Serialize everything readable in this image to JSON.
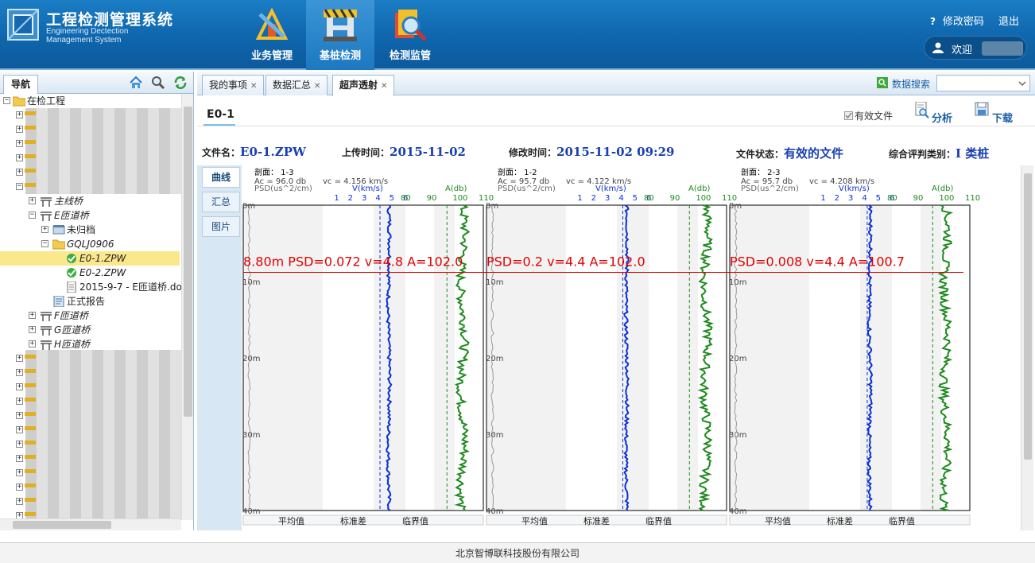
{
  "header": {
    "title": "工程检测管理系统",
    "subtitle_line1": "Engineering Dectection",
    "subtitle_line2": "Management System",
    "nav": [
      {
        "label": "业务管理",
        "icon": "business-management-icon",
        "active": false
      },
      {
        "label": "基桩检测",
        "icon": "pile-inspection-icon",
        "active": true
      },
      {
        "label": "检测监管",
        "icon": "inspection-supervision-icon",
        "active": false
      }
    ],
    "change_password": "修改密码",
    "logout": "退出",
    "welcome": "欢迎",
    "help_icon": "question-mark-icon"
  },
  "sidebar": {
    "tab_label": "导航",
    "home_icon": "home-icon",
    "search_icon": "magnifier-icon",
    "refresh_icon": "refresh-icon",
    "tree": {
      "root": "在检工程",
      "bridge_main": "主线桥",
      "bridge_e": "E匝道桥",
      "unarchived": "未归档",
      "folder": "GQLJ0906",
      "file_e0_1": "E0-1.ZPW",
      "file_e0_2": "E0-2.ZPW",
      "doc_file": "2015-9-7 - E匝道桥.do",
      "formal_report": "正式报告",
      "bridge_f": "F匝道桥",
      "bridge_g": "G匝道桥",
      "bridge_h": "H匝道桥"
    }
  },
  "tabs": [
    {
      "label": "我的事项",
      "active": false
    },
    {
      "label": "数据汇总",
      "active": false
    },
    {
      "label": "超声透射",
      "active": true
    }
  ],
  "data_search": {
    "label": "数据搜索",
    "value": ""
  },
  "document": {
    "title": "E0-1",
    "valid_file_checkbox": "有效文件",
    "valid_checked": true,
    "analyze_label": "分析",
    "download_label": "下载",
    "file_name_key": "文件名：",
    "file_name": "E0-1.ZPW",
    "upload_time_key": "上传时间：",
    "upload_time": "2015-11-02",
    "modify_time_key": "修改时间：",
    "modify_time": "2015-11-02 09:29",
    "file_status_key": "文件状态：",
    "file_status": "有效的文件",
    "category_key": "综合评判类别：",
    "category": "I 类桩"
  },
  "side_tabs": [
    {
      "label": "曲线",
      "active": true
    },
    {
      "label": "汇总",
      "active": false
    },
    {
      "label": "图片",
      "active": false
    }
  ],
  "chart_data": [
    {
      "type": "line",
      "section": "剖面：  1-3",
      "ac": "Ac = 96.0 db",
      "vc": "vc = 4.156 km/s",
      "psd_axis": "PSD(us^2/cm)",
      "v_axis": "V(km/s)",
      "a_axis": "A(db)",
      "v_ticks": [
        "1",
        "2",
        "3",
        "4",
        "5",
        "6"
      ],
      "a_ticks": [
        "80",
        "90",
        "100",
        "110"
      ],
      "depth_ticks": [
        "0m",
        "10m",
        "20m",
        "30m",
        "40m"
      ],
      "depth_range": [
        0,
        40
      ],
      "v_range": [
        0,
        6
      ],
      "a_range": [
        80,
        110
      ],
      "cursor_depth_m": 8.8,
      "cursor_label": "8.80m PSD=0.072 v=4.8 A=102.0",
      "v_critical": 4.156,
      "a_critical": 96.0,
      "v_mean": 4.8,
      "a_mean": 102.0,
      "series": [
        {
          "name": "V(km/s)",
          "color": "#0a2fd8",
          "x": "V"
        },
        {
          "name": "A(db)",
          "color": "#1e8a1e",
          "x": "A"
        }
      ],
      "footer_cols": [
        "平均值",
        "标准差",
        "临界值"
      ]
    },
    {
      "type": "line",
      "section": "剖面：  1-2",
      "ac": "Ac = 95.7 db",
      "vc": "vc = 4.122 km/s",
      "psd_axis": "PSD(us^2/cm)",
      "v_axis": "V(km/s)",
      "a_axis": "A(db)",
      "v_ticks": [
        "1",
        "2",
        "3",
        "4",
        "5",
        "6"
      ],
      "a_ticks": [
        "80",
        "90",
        "100",
        "110"
      ],
      "depth_ticks": [
        "0m",
        "10m",
        "20m",
        "30m",
        "40m"
      ],
      "depth_range": [
        0,
        40
      ],
      "v_range": [
        0,
        6
      ],
      "a_range": [
        80,
        110
      ],
      "cursor_depth_m": 8.8,
      "cursor_label": "PSD=0.2 v=4.4 A=102.0",
      "v_critical": 4.122,
      "a_critical": 95.7,
      "v_mean": 4.4,
      "a_mean": 102.0,
      "series": [
        {
          "name": "V(km/s)",
          "color": "#0a2fd8",
          "x": "V"
        },
        {
          "name": "A(db)",
          "color": "#1e8a1e",
          "x": "A"
        }
      ],
      "footer_cols": [
        "平均值",
        "标准差",
        "临界值"
      ]
    },
    {
      "type": "line",
      "section": "剖面：  2-3",
      "ac": "Ac = 95.7 db",
      "vc": "vc = 4.208 km/s",
      "psd_axis": "PSD(us^2/cm)",
      "v_axis": "V(km/s)",
      "a_axis": "A(db)",
      "v_ticks": [
        "1",
        "2",
        "3",
        "4",
        "5",
        "6"
      ],
      "a_ticks": [
        "80",
        "90",
        "100",
        "110"
      ],
      "depth_ticks": [
        "0m",
        "10m",
        "20m",
        "30m",
        "40m"
      ],
      "depth_range": [
        0,
        40
      ],
      "v_range": [
        0,
        6
      ],
      "a_range": [
        80,
        110
      ],
      "cursor_depth_m": 8.8,
      "cursor_label": "PSD=0.008 v=4.4 A=100.7",
      "v_critical": 4.208,
      "a_critical": 95.7,
      "v_mean": 4.4,
      "a_mean": 100.7,
      "series": [
        {
          "name": "V(km/s)",
          "color": "#0a2fd8",
          "x": "V"
        },
        {
          "name": "A(db)",
          "color": "#1e8a1e",
          "x": "A"
        }
      ],
      "footer_cols": [
        "平均值",
        "标准差",
        "临界值"
      ]
    }
  ],
  "footer": {
    "company": "北京智博联科技股份有限公司"
  }
}
